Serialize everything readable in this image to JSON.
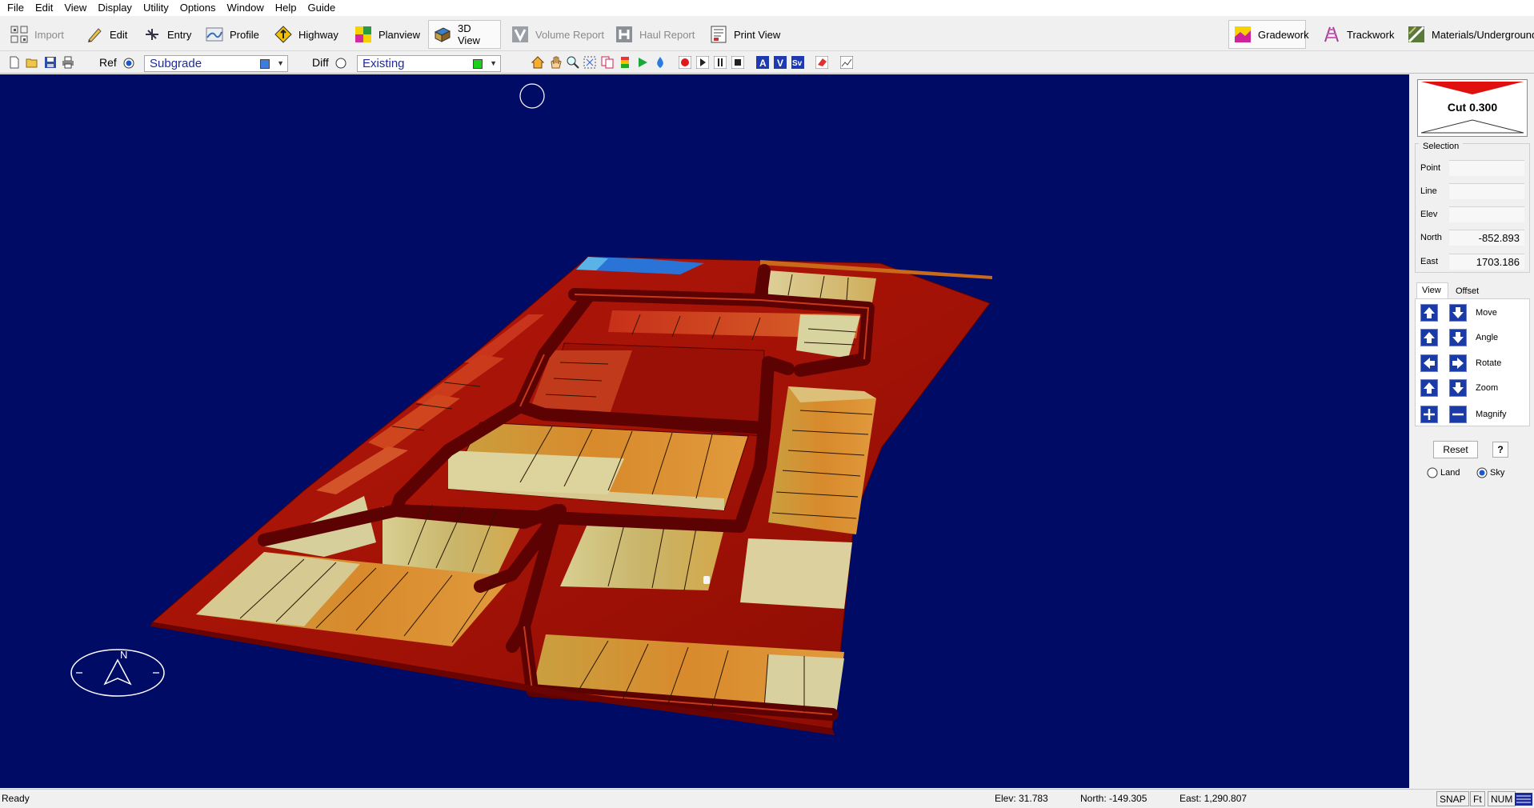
{
  "menu": [
    "File",
    "Edit",
    "View",
    "Display",
    "Utility",
    "Options",
    "Window",
    "Help",
    "Guide"
  ],
  "toolbar": {
    "import": "Import",
    "edit": "Edit",
    "entry": "Entry",
    "profile": "Profile",
    "highway": "Highway",
    "planview": "Planview",
    "view3d": "3D View",
    "volume_report": "Volume Report",
    "haul_report": "Haul Report",
    "print_view": "Print View",
    "gradework": "Gradework",
    "trackwork": "Trackwork",
    "materials": "Materials/Underground"
  },
  "surfaces": {
    "ref_label": "Ref",
    "ref_value": "Subgrade",
    "ref_color": "#3c7de0",
    "diff_label": "Diff",
    "diff_value": "Existing",
    "diff_color": "#19d219"
  },
  "colors": {
    "background": "#000b66",
    "accent": "#e0100e"
  },
  "right_panel": {
    "cut_label": "Cut 0.300",
    "selection_title": "Selection",
    "point_label": "Point",
    "point_value": "",
    "line_label": "Line",
    "line_value": "",
    "elev_label": "Elev",
    "elev_value": "",
    "north_label": "North",
    "north_value": "-852.893",
    "east_label": "East",
    "east_value": "1703.186",
    "tab_view": "View",
    "tab_offset": "Offset",
    "move": "Move",
    "angle": "Angle",
    "rotate": "Rotate",
    "zoom": "Zoom",
    "magnify": "Magnify",
    "reset": "Reset",
    "help": "?",
    "land": "Land",
    "sky": "Sky",
    "selected_mode": "Sky"
  },
  "status": {
    "ready": "Ready",
    "elev": "Elev: 31.783",
    "north": "North: -149.305",
    "east": "East: 1,290.807",
    "snap": "SNAP",
    "ft": "Ft",
    "num": "NUM"
  },
  "compass": {
    "north_letter": "N"
  }
}
